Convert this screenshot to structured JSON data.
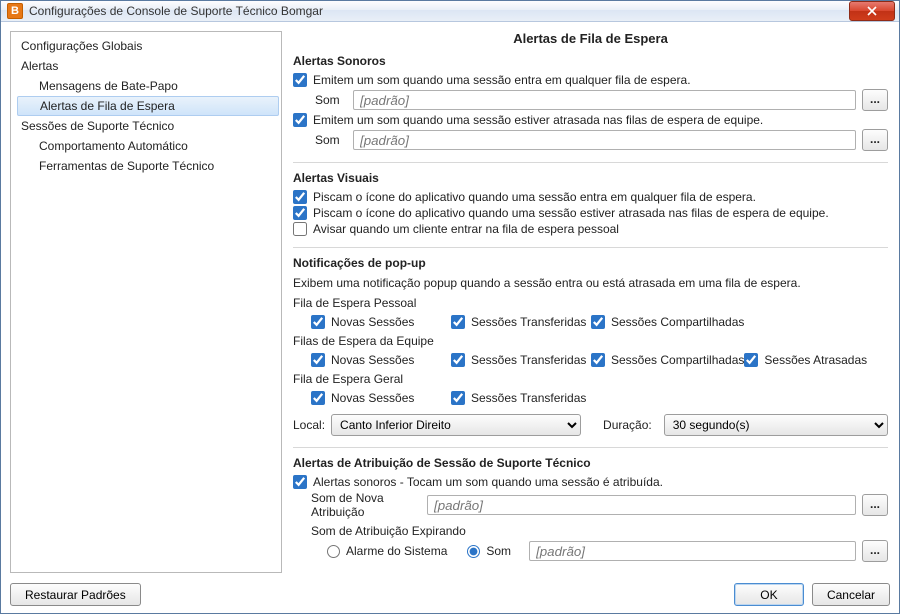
{
  "window": {
    "app_icon_letter": "B",
    "title": "Configurações de Console de Suporte Técnico Bomgar"
  },
  "nav": {
    "items": [
      {
        "label": "Configurações Globais",
        "level": 0,
        "selected": false
      },
      {
        "label": "Alertas",
        "level": 0,
        "selected": false
      },
      {
        "label": "Mensagens de Bate-Papo",
        "level": 1,
        "selected": false
      },
      {
        "label": "Alertas de Fila de Espera",
        "level": 1,
        "selected": true
      },
      {
        "label": "Sessões de Suporte Técnico",
        "level": 0,
        "selected": false
      },
      {
        "label": "Comportamento Automático",
        "level": 1,
        "selected": false
      },
      {
        "label": "Ferramentas de Suporte Técnico",
        "level": 1,
        "selected": false
      }
    ]
  },
  "page": {
    "heading": "Alertas de Fila de Espera",
    "audible": {
      "title": "Alertas Sonoros",
      "chk1": "Emitem um som quando uma sessão entra em qualquer fila de espera.",
      "sound_label": "Som",
      "sound1_value": "[padrão]",
      "chk2": "Emitem um som quando uma sessão estiver atrasada nas filas de espera de equipe.",
      "sound2_value": "[padrão]",
      "browse": "..."
    },
    "visual": {
      "title": "Alertas Visuais",
      "chk1": "Piscam o ícone do aplicativo quando uma sessão entra em qualquer fila de espera.",
      "chk2": "Piscam o ícone do aplicativo quando uma sessão estiver atrasada nas filas de espera de equipe.",
      "chk3": "Avisar quando um cliente entrar na fila de espera pessoal"
    },
    "popup": {
      "title": "Notificações de pop-up",
      "desc": "Exibem uma notificação popup quando a sessão entra ou está atrasada em uma fila de espera.",
      "personal_title": "Fila de Espera Pessoal",
      "team_title": "Filas de Espera da Equipe",
      "general_title": "Fila de Espera Geral",
      "new_sessions": "Novas Sessões",
      "transferred": "Sessões Transferidas",
      "shared": "Sessões Compartilhadas",
      "overdue": "Sessões Atrasadas",
      "location_label": "Local:",
      "location_value": "Canto Inferior Direito",
      "duration_label": "Duração:",
      "duration_value": "30 segundo(s)"
    },
    "assign": {
      "title": "Alertas de Atribuição de Sessão de Suporte Técnico",
      "chk1": "Alertas sonoros - Tocam um som quando uma sessão é atribuída.",
      "new_assign_label": "Som de Nova Atribuição",
      "new_assign_value": "[padrão]",
      "expiring_label": "Som de Atribuição Expirando",
      "radio_alarm": "Alarme do Sistema",
      "radio_sound": "Som",
      "expiring_value": "[padrão]",
      "browse": "..."
    }
  },
  "footer": {
    "restore": "Restaurar Padrões",
    "ok": "OK",
    "cancel": "Cancelar"
  }
}
